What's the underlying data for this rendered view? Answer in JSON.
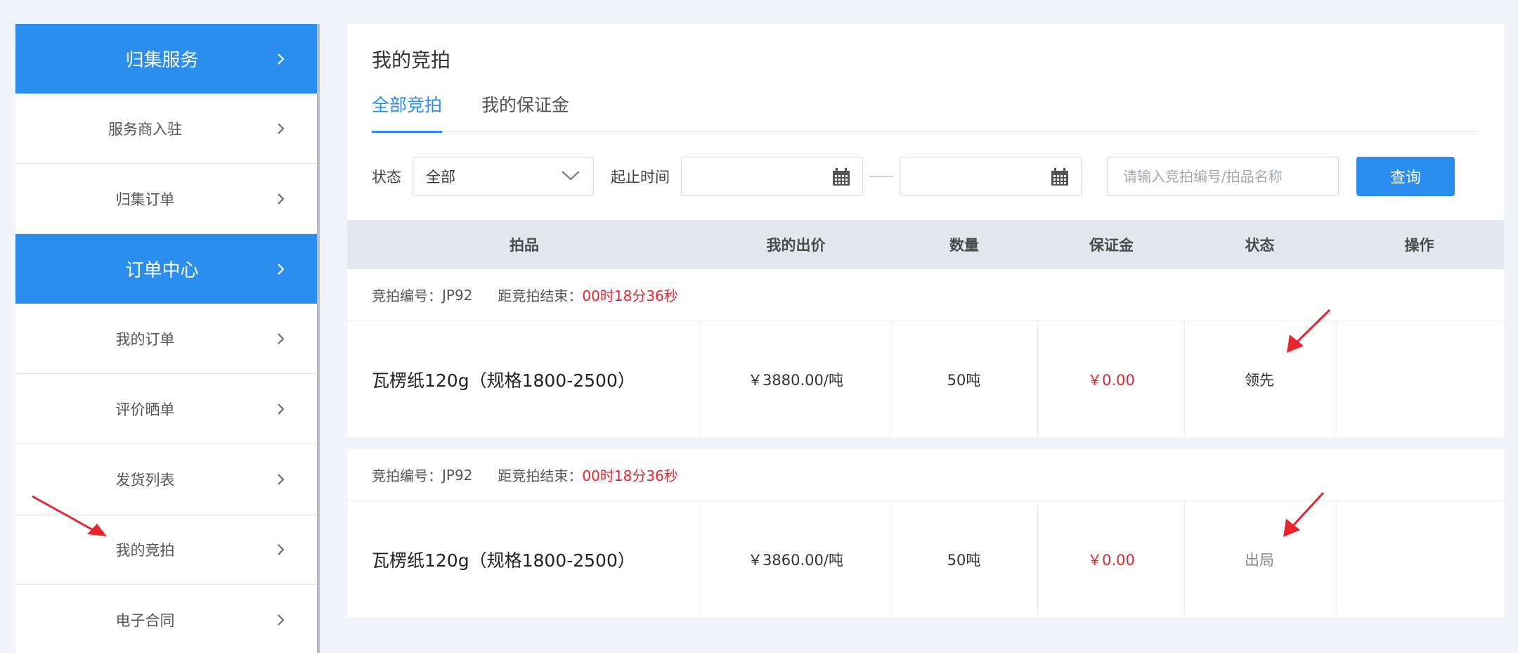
{
  "sidebar": {
    "items": [
      {
        "label": "归集服务",
        "type": "group"
      },
      {
        "label": "服务商入驻",
        "type": "item"
      },
      {
        "label": "归集订单",
        "type": "item"
      },
      {
        "label": "订单中心",
        "type": "group"
      },
      {
        "label": "我的订单",
        "type": "item"
      },
      {
        "label": "评价晒单",
        "type": "item"
      },
      {
        "label": "发货列表",
        "type": "item"
      },
      {
        "label": "我的竞拍",
        "type": "item"
      },
      {
        "label": "电子合同",
        "type": "item"
      }
    ]
  },
  "main": {
    "title": "我的竞拍",
    "tabs": [
      {
        "label": "全部竞拍",
        "active": true
      },
      {
        "label": "我的保证金",
        "active": false
      }
    ],
    "filters": {
      "status_label": "状态",
      "status_value": "全部",
      "time_label": "起止时间",
      "search_placeholder": "请输入竞拍编号/拍品名称",
      "query_button": "查询"
    },
    "table": {
      "columns": [
        "拍品",
        "我的出价",
        "数量",
        "保证金",
        "状态",
        "操作"
      ],
      "rows": [
        {
          "bid_no_label": "竞拍编号：",
          "bid_no": "JP92",
          "countdown_label": "距竞拍结束：",
          "countdown": "00时18分36秒",
          "product": "瓦楞纸120g（规格1800-2500）",
          "my_bid": "￥3880.00/吨",
          "quantity": "50吨",
          "deposit": "￥0.00",
          "status": "领先",
          "action": ""
        },
        {
          "bid_no_label": "竞拍编号：",
          "bid_no": "JP92",
          "countdown_label": "距竞拍结束：",
          "countdown": "00时18分36秒",
          "product": "瓦楞纸120g（规格1800-2500）",
          "my_bid": "￥3860.00/吨",
          "quantity": "50吨",
          "deposit": "￥0.00",
          "status": "出局",
          "action": ""
        }
      ]
    }
  },
  "colors": {
    "accent": "#2b8ded",
    "danger": "#e8242c",
    "annotation": "#e8242c"
  }
}
